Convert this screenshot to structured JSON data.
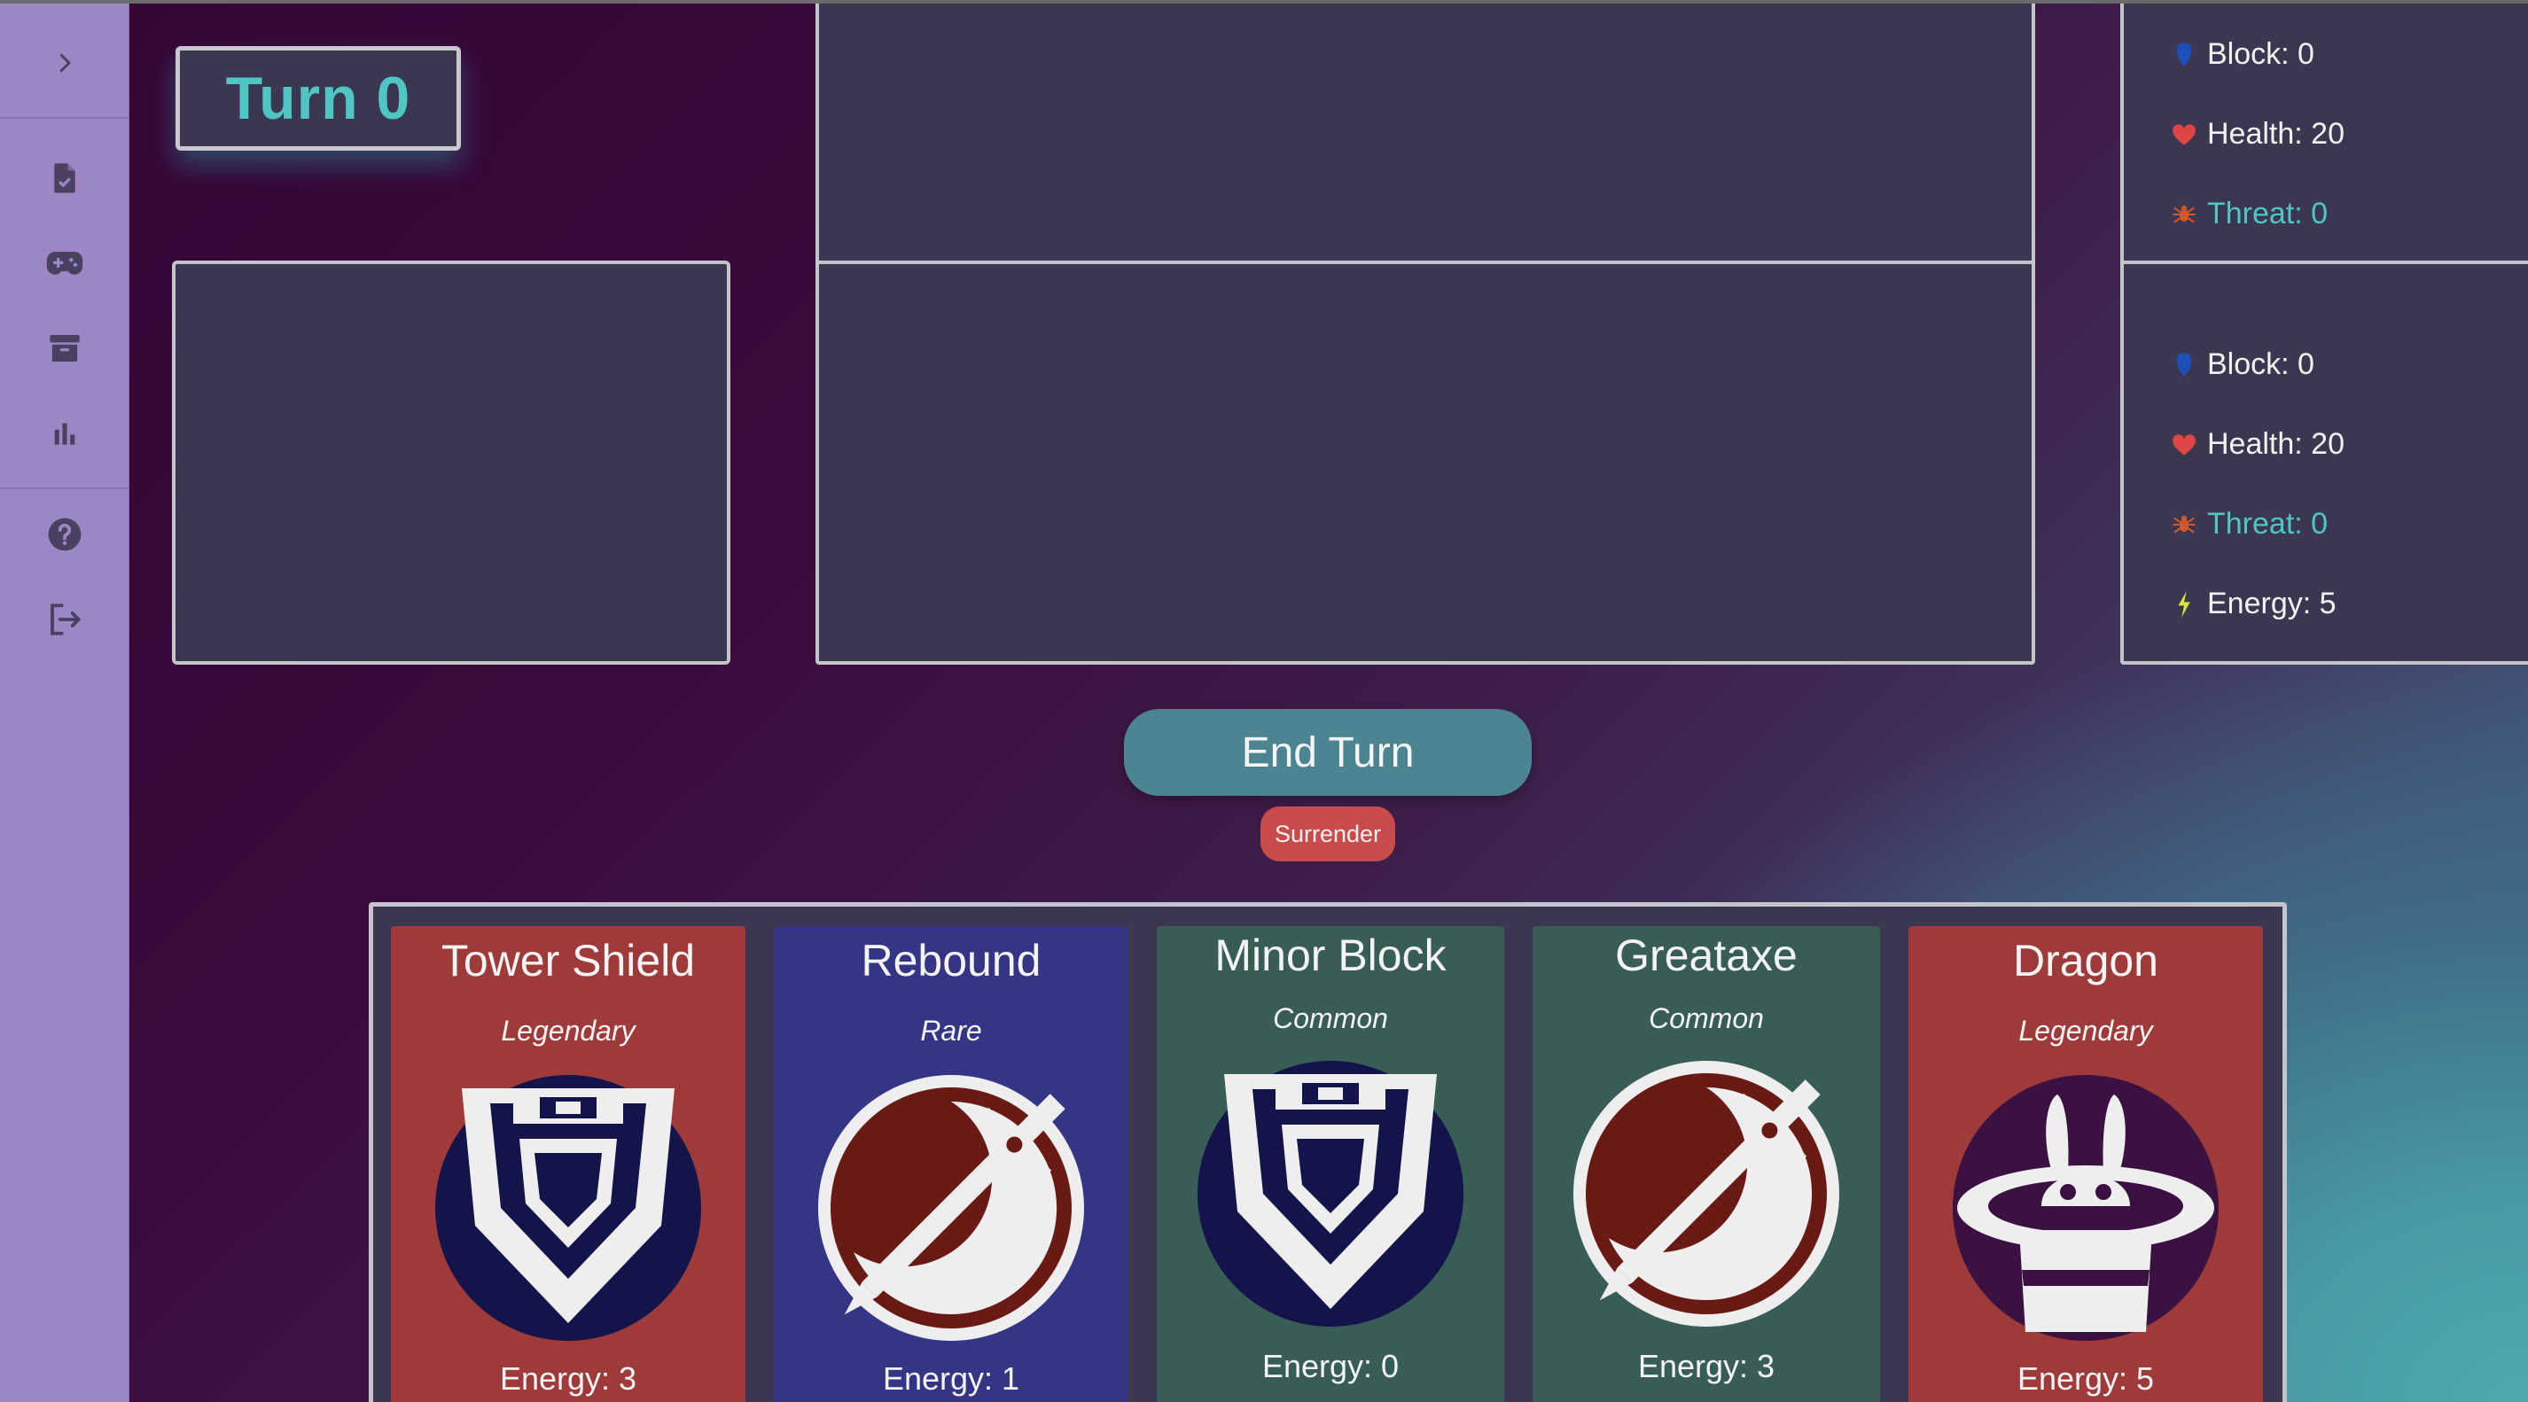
{
  "sidebar": {
    "items": [
      {
        "icon": "chevron-right-icon"
      },
      {
        "icon": "document-check-icon"
      },
      {
        "icon": "gamepad-icon"
      },
      {
        "icon": "archive-icon"
      },
      {
        "icon": "bar-chart-icon"
      },
      {
        "icon": "help-icon"
      },
      {
        "icon": "logout-icon"
      }
    ]
  },
  "turn": {
    "label": "Turn 0"
  },
  "enemy_stats": {
    "block": "Block: 0",
    "health": "Health: 20",
    "threat": "Threat: 0"
  },
  "player_stats": {
    "block": "Block: 0",
    "health": "Health: 20",
    "threat": "Threat: 0",
    "energy": "Energy: 5"
  },
  "actions": {
    "end_turn": "End Turn",
    "surrender": "Surrender"
  },
  "hand": [
    {
      "title": "Tower Shield",
      "rarity": "Legendary",
      "energy": "Energy: 3",
      "art": "shield-icon",
      "color": "#9e3b3a",
      "art_bg": "#13144a"
    },
    {
      "title": "Rebound",
      "rarity": "Rare",
      "energy": "Energy: 1",
      "art": "sword-icon",
      "color": "#353585",
      "art_bg": "#6a1a14"
    },
    {
      "title": "Minor Block",
      "rarity": "Common",
      "energy": "Energy: 0",
      "art": "shield-icon",
      "color": "#385c56",
      "art_bg": "#13144a"
    },
    {
      "title": "Greataxe",
      "rarity": "Common",
      "energy": "Energy: 3",
      "art": "sword-icon",
      "color": "#385c56",
      "art_bg": "#6a1a14"
    },
    {
      "title": "Dragon",
      "rarity": "Legendary",
      "energy": "Energy: 5",
      "art": "magic-hat-icon",
      "color": "#9e3b3a",
      "art_bg": "#3a1141"
    }
  ],
  "colors": {
    "sidebar": "#9a87c4",
    "panel": "#3c3750",
    "accent": "#4fc6c3",
    "end_turn": "#4c8591",
    "surrender": "#c94c4c"
  }
}
